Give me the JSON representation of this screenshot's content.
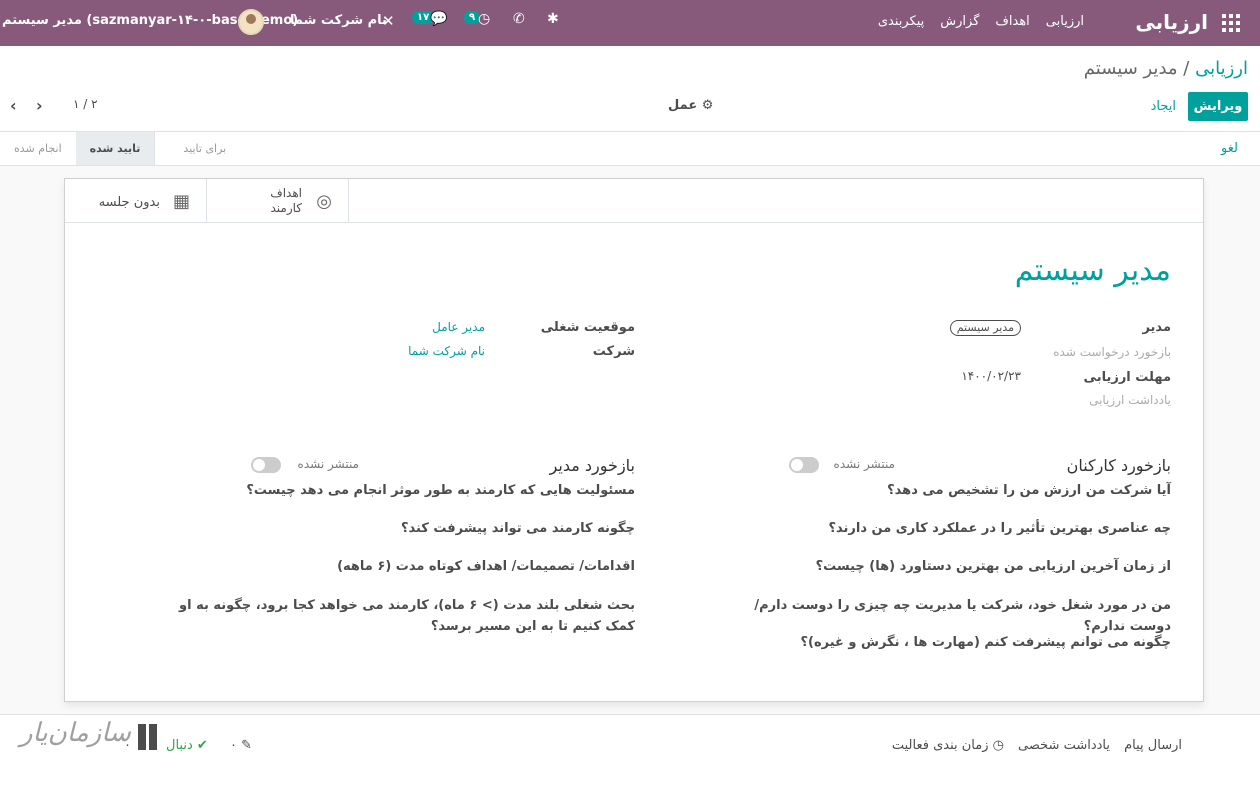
{
  "navbar": {
    "app_name": "ارزیابی",
    "menu": [
      "ارزیابی",
      "اهداف",
      "گزارش",
      "پیکربندی"
    ],
    "user": "مدیر سیستم (sazmanyar-۱۴-۰-base-demo)",
    "company": "نام شرکت شما",
    "badge_activity": "۹",
    "badge_messages": "۱۷"
  },
  "control_panel": {
    "breadcrumb_parent": "ارزیابی",
    "breadcrumb_separator": "/",
    "breadcrumb_current": "مدیر سیستم",
    "edit_label": "ویرایش",
    "create_label": "ایجاد",
    "action_label": "عمل",
    "pager_value": "۱ / ۲"
  },
  "statusbar": {
    "cancel_label": "لغو",
    "stages": [
      {
        "label": "برای تایید",
        "active": false
      },
      {
        "label": "تایید شده",
        "active": true
      },
      {
        "label": "انجام شده",
        "active": false
      }
    ]
  },
  "smart_buttons": {
    "goals_line1": "اهداف",
    "goals_line2": "کارمند",
    "meeting_label": "بدون جلسه"
  },
  "form": {
    "employee_name": "مدیر سیستم",
    "manager_label": "مدیر",
    "manager_value": "مدیر سیستم",
    "feedback_requested_label": "بازخورد درخواست شده",
    "deadline_label": "مهلت ارزیابی",
    "deadline_value": "۱۴۰۰/۰۲/۲۳",
    "note_label": "یادداشت ارزیابی",
    "job_label": "موقعیت شغلی",
    "job_value": "مدیر عامل",
    "company_label": "شرکت",
    "company_value": "نام شرکت شما"
  },
  "employee_feedback": {
    "title": "بازخورد کارکنان",
    "toggle_label": "منتشر نشده",
    "questions": [
      "آیا شرکت من ارزش من را تشخیص می دهد؟",
      "چه عناصری بهترین تأثیر را در عملکرد کاری من دارند؟",
      "از زمان آخرین ارزیابی من بهترین دستاورد (ها) چیست؟",
      "من در مورد شغل خود، شرکت یا مدیریت چه چیزی را دوست دارم/ دوست ندارم؟",
      "چگونه می توانم پیشرفت کنم (مهارت ها ، نگرش و غیره)؟"
    ]
  },
  "manager_feedback": {
    "title": "بازخورد مدیر",
    "toggle_label": "منتشر نشده",
    "questions": [
      "مسئولیت هایی که کارمند به طور موثر انجام می دهد چیست؟",
      "چگونه کارمند می تواند پیشرفت کند؟",
      "اقدامات/ تصمیمات/ اهداف کوتاه مدت (۶ ماهه)",
      "بحث شغلی بلند مدت (> ۶ ماه)، کارمند می خواهد کجا برود، چگونه به او کمک کنیم تا به این مسیر برسد؟"
    ]
  },
  "chatter": {
    "send_message": "ارسال پیام",
    "log_note": "یادداشت شخصی",
    "schedule_activity": "زمان بندی فعالیت",
    "follow_label": "دنبال",
    "attachments_count": "۰",
    "followers_count": "۰"
  },
  "watermark": {
    "text": "سازمان‌یار"
  }
}
